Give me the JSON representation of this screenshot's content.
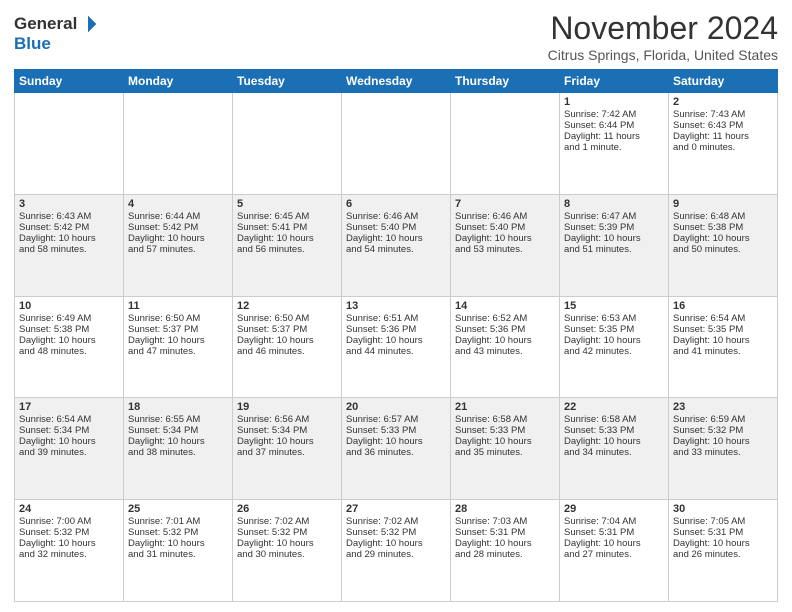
{
  "header": {
    "logo_general": "General",
    "logo_blue": "Blue",
    "month_title": "November 2024",
    "location": "Citrus Springs, Florida, United States"
  },
  "weekdays": [
    "Sunday",
    "Monday",
    "Tuesday",
    "Wednesday",
    "Thursday",
    "Friday",
    "Saturday"
  ],
  "weeks": [
    [
      {
        "day": "",
        "info": "",
        "empty": true
      },
      {
        "day": "",
        "info": "",
        "empty": true
      },
      {
        "day": "",
        "info": "",
        "empty": true
      },
      {
        "day": "",
        "info": "",
        "empty": true
      },
      {
        "day": "",
        "info": "",
        "empty": true
      },
      {
        "day": "1",
        "info": "Sunrise: 7:42 AM\nSunset: 6:44 PM\nDaylight: 11 hours\nand 1 minute.",
        "empty": false
      },
      {
        "day": "2",
        "info": "Sunrise: 7:43 AM\nSunset: 6:43 PM\nDaylight: 11 hours\nand 0 minutes.",
        "empty": false
      }
    ],
    [
      {
        "day": "3",
        "info": "Sunrise: 6:43 AM\nSunset: 5:42 PM\nDaylight: 10 hours\nand 58 minutes.",
        "empty": false
      },
      {
        "day": "4",
        "info": "Sunrise: 6:44 AM\nSunset: 5:42 PM\nDaylight: 10 hours\nand 57 minutes.",
        "empty": false
      },
      {
        "day": "5",
        "info": "Sunrise: 6:45 AM\nSunset: 5:41 PM\nDaylight: 10 hours\nand 56 minutes.",
        "empty": false
      },
      {
        "day": "6",
        "info": "Sunrise: 6:46 AM\nSunset: 5:40 PM\nDaylight: 10 hours\nand 54 minutes.",
        "empty": false
      },
      {
        "day": "7",
        "info": "Sunrise: 6:46 AM\nSunset: 5:40 PM\nDaylight: 10 hours\nand 53 minutes.",
        "empty": false
      },
      {
        "day": "8",
        "info": "Sunrise: 6:47 AM\nSunset: 5:39 PM\nDaylight: 10 hours\nand 51 minutes.",
        "empty": false
      },
      {
        "day": "9",
        "info": "Sunrise: 6:48 AM\nSunset: 5:38 PM\nDaylight: 10 hours\nand 50 minutes.",
        "empty": false
      }
    ],
    [
      {
        "day": "10",
        "info": "Sunrise: 6:49 AM\nSunset: 5:38 PM\nDaylight: 10 hours\nand 48 minutes.",
        "empty": false
      },
      {
        "day": "11",
        "info": "Sunrise: 6:50 AM\nSunset: 5:37 PM\nDaylight: 10 hours\nand 47 minutes.",
        "empty": false
      },
      {
        "day": "12",
        "info": "Sunrise: 6:50 AM\nSunset: 5:37 PM\nDaylight: 10 hours\nand 46 minutes.",
        "empty": false
      },
      {
        "day": "13",
        "info": "Sunrise: 6:51 AM\nSunset: 5:36 PM\nDaylight: 10 hours\nand 44 minutes.",
        "empty": false
      },
      {
        "day": "14",
        "info": "Sunrise: 6:52 AM\nSunset: 5:36 PM\nDaylight: 10 hours\nand 43 minutes.",
        "empty": false
      },
      {
        "day": "15",
        "info": "Sunrise: 6:53 AM\nSunset: 5:35 PM\nDaylight: 10 hours\nand 42 minutes.",
        "empty": false
      },
      {
        "day": "16",
        "info": "Sunrise: 6:54 AM\nSunset: 5:35 PM\nDaylight: 10 hours\nand 41 minutes.",
        "empty": false
      }
    ],
    [
      {
        "day": "17",
        "info": "Sunrise: 6:54 AM\nSunset: 5:34 PM\nDaylight: 10 hours\nand 39 minutes.",
        "empty": false
      },
      {
        "day": "18",
        "info": "Sunrise: 6:55 AM\nSunset: 5:34 PM\nDaylight: 10 hours\nand 38 minutes.",
        "empty": false
      },
      {
        "day": "19",
        "info": "Sunrise: 6:56 AM\nSunset: 5:34 PM\nDaylight: 10 hours\nand 37 minutes.",
        "empty": false
      },
      {
        "day": "20",
        "info": "Sunrise: 6:57 AM\nSunset: 5:33 PM\nDaylight: 10 hours\nand 36 minutes.",
        "empty": false
      },
      {
        "day": "21",
        "info": "Sunrise: 6:58 AM\nSunset: 5:33 PM\nDaylight: 10 hours\nand 35 minutes.",
        "empty": false
      },
      {
        "day": "22",
        "info": "Sunrise: 6:58 AM\nSunset: 5:33 PM\nDaylight: 10 hours\nand 34 minutes.",
        "empty": false
      },
      {
        "day": "23",
        "info": "Sunrise: 6:59 AM\nSunset: 5:32 PM\nDaylight: 10 hours\nand 33 minutes.",
        "empty": false
      }
    ],
    [
      {
        "day": "24",
        "info": "Sunrise: 7:00 AM\nSunset: 5:32 PM\nDaylight: 10 hours\nand 32 minutes.",
        "empty": false
      },
      {
        "day": "25",
        "info": "Sunrise: 7:01 AM\nSunset: 5:32 PM\nDaylight: 10 hours\nand 31 minutes.",
        "empty": false
      },
      {
        "day": "26",
        "info": "Sunrise: 7:02 AM\nSunset: 5:32 PM\nDaylight: 10 hours\nand 30 minutes.",
        "empty": false
      },
      {
        "day": "27",
        "info": "Sunrise: 7:02 AM\nSunset: 5:32 PM\nDaylight: 10 hours\nand 29 minutes.",
        "empty": false
      },
      {
        "day": "28",
        "info": "Sunrise: 7:03 AM\nSunset: 5:31 PM\nDaylight: 10 hours\nand 28 minutes.",
        "empty": false
      },
      {
        "day": "29",
        "info": "Sunrise: 7:04 AM\nSunset: 5:31 PM\nDaylight: 10 hours\nand 27 minutes.",
        "empty": false
      },
      {
        "day": "30",
        "info": "Sunrise: 7:05 AM\nSunset: 5:31 PM\nDaylight: 10 hours\nand 26 minutes.",
        "empty": false
      }
    ]
  ],
  "row_styles": [
    "row-white",
    "row-shaded",
    "row-white",
    "row-shaded",
    "row-white"
  ]
}
